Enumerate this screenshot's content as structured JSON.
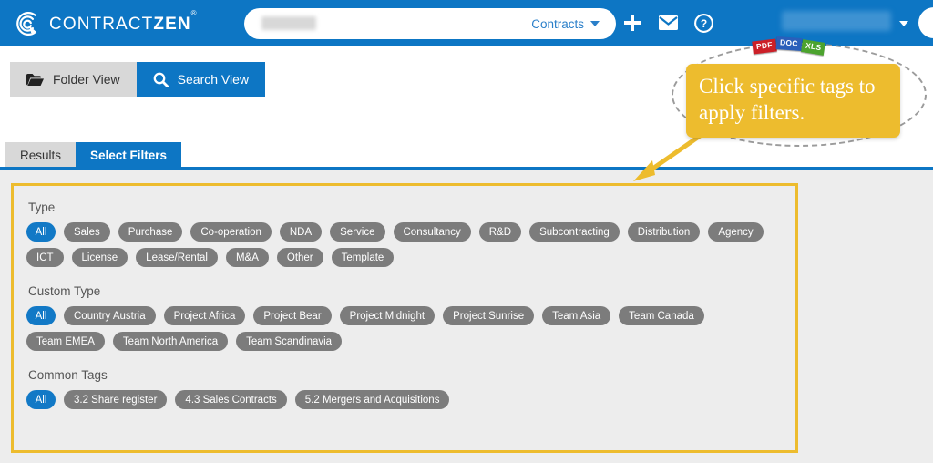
{
  "header": {
    "brand_primary": "CONTRACT",
    "brand_secondary": "ZEN",
    "brand_registered": "®",
    "logo_icon": "contractzen-c-logo-icon",
    "search": {
      "value": "",
      "placeholder": "",
      "scope_label": "Contracts",
      "scope_caret_icon": "chevron-down-icon"
    },
    "icons": [
      {
        "name": "plus-icon",
        "label": "New"
      },
      {
        "name": "envelope-icon",
        "label": "Messages"
      },
      {
        "name": "question-circle-icon",
        "label": "Help"
      }
    ],
    "user_menu_caret_icon": "chevron-down-icon",
    "accent_blue": "#0d76c4"
  },
  "viewbar": {
    "buttons": [
      {
        "label": "Folder View",
        "icon": "folder-icon",
        "active": false
      },
      {
        "label": "Search View",
        "icon": "search-icon",
        "active": true
      }
    ]
  },
  "tabs": [
    {
      "label": "Results",
      "active": false
    },
    {
      "label": "Select Filters",
      "active": true
    }
  ],
  "filters": {
    "border_color": "#edbc2e",
    "groups": [
      {
        "label": "Type",
        "tags": [
          {
            "label": "All",
            "active": true
          },
          {
            "label": "Sales",
            "active": false
          },
          {
            "label": "Purchase",
            "active": false
          },
          {
            "label": "Co-operation",
            "active": false
          },
          {
            "label": "NDA",
            "active": false
          },
          {
            "label": "Service",
            "active": false
          },
          {
            "label": "Consultancy",
            "active": false
          },
          {
            "label": "R&D",
            "active": false
          },
          {
            "label": "Subcontracting",
            "active": false
          },
          {
            "label": "Distribution",
            "active": false
          },
          {
            "label": "Agency",
            "active": false
          },
          {
            "label": "ICT",
            "active": false
          },
          {
            "label": "License",
            "active": false
          },
          {
            "label": "Lease/Rental",
            "active": false
          },
          {
            "label": "M&A",
            "active": false
          },
          {
            "label": "Other",
            "active": false
          },
          {
            "label": "Template",
            "active": false
          }
        ]
      },
      {
        "label": "Custom Type",
        "tags": [
          {
            "label": "All",
            "active": true
          },
          {
            "label": "Country Austria",
            "active": false
          },
          {
            "label": "Project Africa",
            "active": false
          },
          {
            "label": "Project Bear",
            "active": false
          },
          {
            "label": "Project Midnight",
            "active": false
          },
          {
            "label": "Project Sunrise",
            "active": false
          },
          {
            "label": "Team Asia",
            "active": false
          },
          {
            "label": "Team Canada",
            "active": false
          },
          {
            "label": "Team EMEA",
            "active": false
          },
          {
            "label": "Team North America",
            "active": false
          },
          {
            "label": "Team Scandinavia",
            "active": false
          }
        ]
      },
      {
        "label": "Common Tags",
        "tags": [
          {
            "label": "All",
            "active": true
          },
          {
            "label": "3.2 Share register",
            "active": false
          },
          {
            "label": "4.3 Sales Contracts",
            "active": false
          },
          {
            "label": "5.2 Mergers and Acquisitions",
            "active": false
          }
        ]
      }
    ]
  },
  "annotation": {
    "text": "Click specific tags to apply filters.",
    "background": "#edbc2e",
    "text_color": "#ffffff",
    "arrow_icon": "arrow-down-left-icon",
    "highlight_shape": "dashed-ellipse"
  },
  "doc_badges": [
    {
      "label": "PDF",
      "color": "#cc2028"
    },
    {
      "label": "DOC",
      "color": "#2a5fba"
    },
    {
      "label": "XLS",
      "color": "#4ca32e"
    }
  ]
}
